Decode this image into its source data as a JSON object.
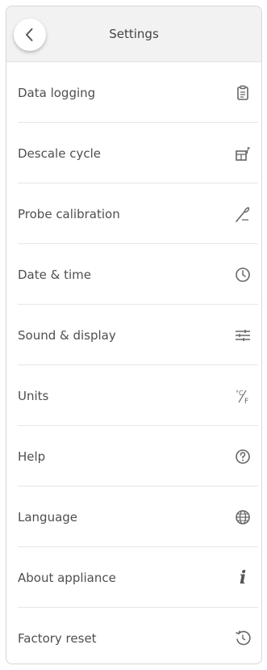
{
  "header": {
    "title": "Settings",
    "back_icon": "chevron-left-icon"
  },
  "menu": {
    "items": [
      {
        "label": "Data logging",
        "icon": "clipboard-icon"
      },
      {
        "label": "Descale cycle",
        "icon": "descale-icon"
      },
      {
        "label": "Probe calibration",
        "icon": "probe-icon"
      },
      {
        "label": "Date & time",
        "icon": "clock-icon"
      },
      {
        "label": "Sound & display",
        "icon": "sliders-icon"
      },
      {
        "label": "Units",
        "icon": "units-icon",
        "icon_text_c": "°C",
        "icon_text_f": "F"
      },
      {
        "label": "Help",
        "icon": "help-icon"
      },
      {
        "label": "Language",
        "icon": "globe-icon"
      },
      {
        "label": "About appliance",
        "icon": "info-icon",
        "icon_text": "i"
      },
      {
        "label": "Factory reset",
        "icon": "reset-icon"
      }
    ]
  }
}
